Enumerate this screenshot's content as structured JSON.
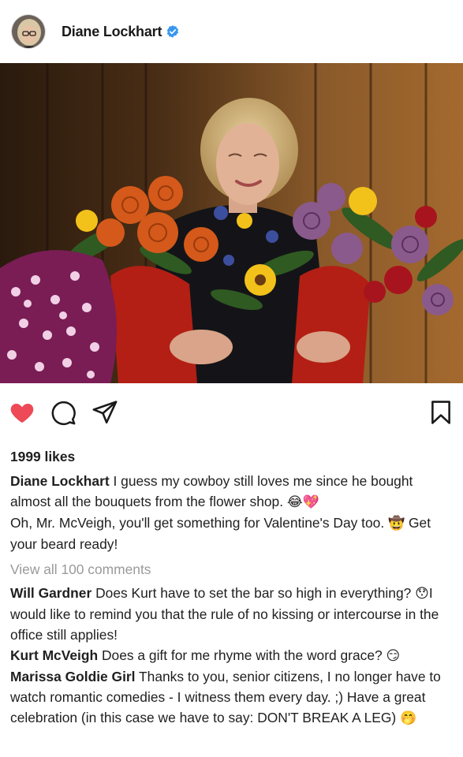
{
  "post": {
    "author": "Diane Lockhart",
    "verified": true,
    "liked": true,
    "likes_text": "1999 likes",
    "caption_lines": [
      "I guess my cowboy still loves me since he bought almost all the bouquets from the flower shop.",
      "Oh, Mr. McVeigh, you'll get something for Valentine's Day too.",
      "Get your beard ready!"
    ],
    "caption_emojis": [
      "😂",
      "💖",
      "🤠"
    ],
    "view_all_comments": "View all 100 comments"
  },
  "comments": [
    {
      "author": "Will Gardner",
      "text_a": "Does Kurt have to set the bar so high in everything?",
      "emoji": "😯",
      "text_b": "I would like to remind you that the rule of no kissing or intercourse in the office still applies!"
    },
    {
      "author": "Kurt McVeigh",
      "text_a": "Does a gift for me rhyme with the word grace?",
      "emoji": "😏",
      "text_b": ""
    },
    {
      "author": "Marissa Goldie Girl",
      "text_a": "Thanks to you, senior citizens, I no longer have to watch romantic comedies - I witness them every day. ;) Have a great celebration (in this case we have to say: DON'T BREAK A LEG)",
      "emoji": "🤭",
      "text_b": ""
    }
  ],
  "colors": {
    "like_red": "#ed4956",
    "verified_blue": "#3897f0",
    "muted_gray": "#9a9a9a"
  },
  "icons": [
    "avatar",
    "verified-badge-icon",
    "heart-icon",
    "comment-icon",
    "share-icon",
    "bookmark-icon"
  ]
}
